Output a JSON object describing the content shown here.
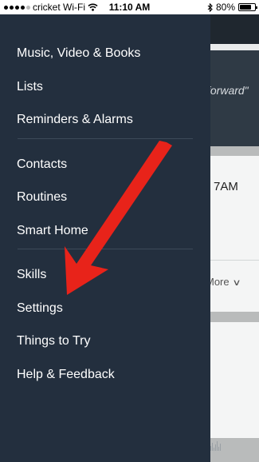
{
  "status_bar": {
    "carrier": "cricket Wi-Fi",
    "time": "11:10 AM",
    "battery": "80%",
    "battery_level": 0.8,
    "icons": [
      "signal-dots-icon",
      "wifi-icon",
      "bluetooth-icon",
      "battery-icon"
    ]
  },
  "menu": {
    "groups": [
      [
        "Music, Video & Books",
        "Lists",
        "Reminders & Alarms"
      ],
      [
        "Contacts",
        "Routines",
        "Smart Home"
      ],
      [
        "Skills",
        "Settings",
        "Things to Try",
        "Help & Feedback"
      ]
    ]
  },
  "background": {
    "quote_fragment": "forward\"",
    "time_fragment": "7AM",
    "more_label": "More"
  },
  "colors": {
    "drawer": "#232f3e",
    "arrow": "#e8231a",
    "separator": "#3d4a59"
  }
}
